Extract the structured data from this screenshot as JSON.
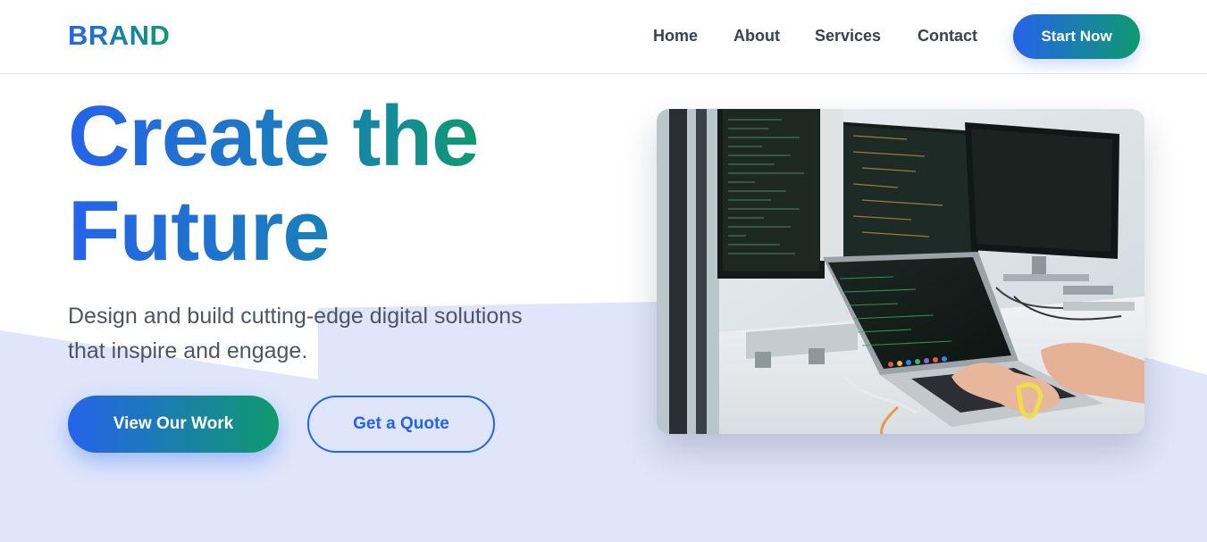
{
  "header": {
    "brand": "BRAND",
    "nav": [
      "Home",
      "About",
      "Services",
      "Contact"
    ],
    "cta_label": "Start Now"
  },
  "hero": {
    "title_line1": "Create the",
    "title_line2": "Future",
    "subtitle_line1": "Design and build cutting-edge digital solutions",
    "subtitle_line2": "that inspire and engage.",
    "primary_button": "View Our Work",
    "secondary_button": "Get a Quote",
    "image_subject": "developer-workstation-photo"
  },
  "colors": {
    "gradient_start": "#2563eb",
    "gradient_end": "#0f9a6e",
    "background_wave": "#dfe6fb",
    "text_body": "#4b5563",
    "nav_text": "#374151"
  }
}
